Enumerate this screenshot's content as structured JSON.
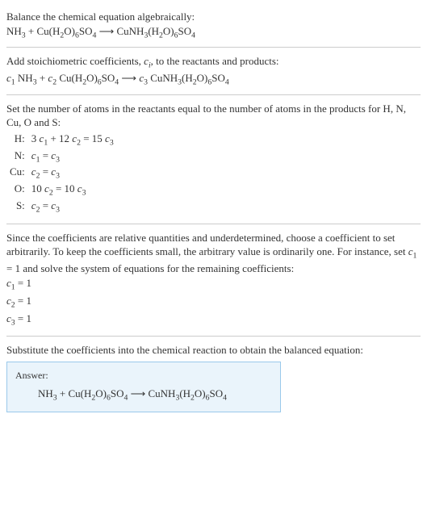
{
  "section1": {
    "line1": "Balance the chemical equation algebraically:",
    "line2_parts": [
      "NH",
      "3",
      " + Cu(H",
      "2",
      "O)",
      "6",
      "SO",
      "4",
      "  ⟶  CuNH",
      "3",
      "(H",
      "2",
      "O)",
      "6",
      "SO",
      "4"
    ]
  },
  "section2": {
    "line1_parts": [
      "Add stoichiometric coefficients, ",
      "c",
      "i",
      ", to the reactants and products:"
    ],
    "line2_parts": [
      "c",
      "1",
      " NH",
      "3",
      " + ",
      "c",
      "2",
      " Cu(H",
      "2",
      "O)",
      "6",
      "SO",
      "4",
      "  ⟶  ",
      "c",
      "3",
      " CuNH",
      "3",
      "(H",
      "2",
      "O)",
      "6",
      "SO",
      "4"
    ]
  },
  "section3": {
    "line1": "Set the number of atoms in the reactants equal to the number of atoms in the products for H, N, Cu, O and S:",
    "rows": [
      {
        "label": "H:",
        "eq_parts": [
          "3 ",
          "c",
          "1",
          " + 12 ",
          "c",
          "2",
          " = 15 ",
          "c",
          "3"
        ]
      },
      {
        "label": "N:",
        "eq_parts": [
          "c",
          "1",
          " = ",
          "c",
          "3"
        ]
      },
      {
        "label": "Cu:",
        "eq_parts": [
          "c",
          "2",
          " = ",
          "c",
          "3"
        ]
      },
      {
        "label": "O:",
        "eq_parts": [
          "10 ",
          "c",
          "2",
          " = 10 ",
          "c",
          "3"
        ]
      },
      {
        "label": "S:",
        "eq_parts": [
          "c",
          "2",
          " = ",
          "c",
          "3"
        ]
      }
    ]
  },
  "section4": {
    "para_parts": [
      "Since the coefficients are relative quantities and underdetermined, choose a coefficient to set arbitrarily. To keep the coefficients small, the arbitrary value is ordinarily one. For instance, set ",
      "c",
      "1",
      " = 1 and solve the system of equations for the remaining coefficients:"
    ],
    "coeffs": [
      [
        "c",
        "1",
        " = 1"
      ],
      [
        "c",
        "2",
        " = 1"
      ],
      [
        "c",
        "3",
        " = 1"
      ]
    ]
  },
  "section5": {
    "line1": "Substitute the coefficients into the chemical reaction to obtain the balanced equation:",
    "answer_label": "Answer:",
    "answer_parts": [
      "NH",
      "3",
      " + Cu(H",
      "2",
      "O)",
      "6",
      "SO",
      "4",
      "  ⟶  CuNH",
      "3",
      "(H",
      "2",
      "O)",
      "6",
      "SO",
      "4"
    ]
  }
}
